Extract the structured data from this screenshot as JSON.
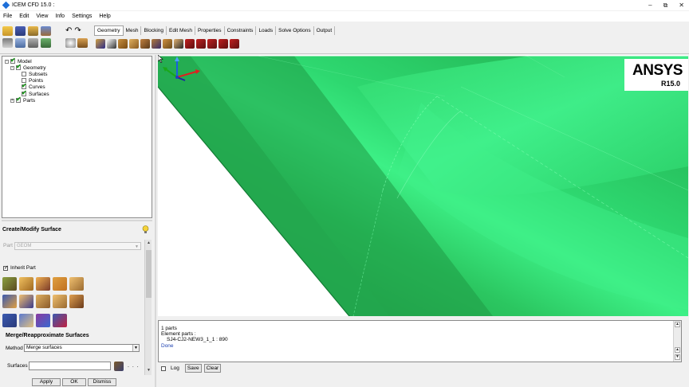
{
  "window": {
    "title": "ICEM CFD 15.0 :",
    "controls": [
      "minimize-icon",
      "restore-icon",
      "close-icon"
    ]
  },
  "menu": [
    "File",
    "Edit",
    "View",
    "Info",
    "Settings",
    "Help"
  ],
  "tabs": [
    "Geometry",
    "Mesh",
    "Blocking",
    "Edit Mesh",
    "Properties",
    "Constraints",
    "Loads",
    "Solve Options",
    "Output"
  ],
  "active_tab": "Geometry",
  "tree": [
    {
      "label": "Model",
      "checked": true,
      "expander": "-"
    },
    {
      "label": "Geometry",
      "checked": true,
      "expander": "-"
    },
    {
      "label": "Subsets",
      "checked": false
    },
    {
      "label": "Points",
      "checked": false
    },
    {
      "label": "Curves",
      "checked": true
    },
    {
      "label": "Surfaces",
      "checked": true
    },
    {
      "label": "Parts",
      "checked": true,
      "expander": "+"
    }
  ],
  "panel": {
    "title": "Create/Modify Surface",
    "part_label": "Part",
    "part_value": "GEOM",
    "inherit_label": "Inherit Part",
    "inherit_checked": true,
    "section_title": "Merge/Reapproximate Surfaces",
    "method_label": "Method",
    "method_value": "Merge surfaces",
    "surfaces_label": "Surfaces",
    "surfaces_value": "",
    "more_label": ". . .",
    "buttons": {
      "apply": "Apply",
      "ok": "OK",
      "dismiss": "Dismiss"
    }
  },
  "viewport": {
    "logo_text": "ANSYS",
    "logo_version": "R15.0",
    "accent_green": "#2fe07a",
    "background": "#ffffff"
  },
  "messages": {
    "lines": [
      "1 parts",
      "Element parts :",
      "   SJ4-CJ2-NEW3_1_1 : 890",
      "Done"
    ],
    "log_label": "Log",
    "log_checked": false,
    "save_label": "Save",
    "clear_label": "Clear"
  },
  "colors": {
    "surface_green": "#2fe07a",
    "status_done": "#1a3fb0"
  }
}
